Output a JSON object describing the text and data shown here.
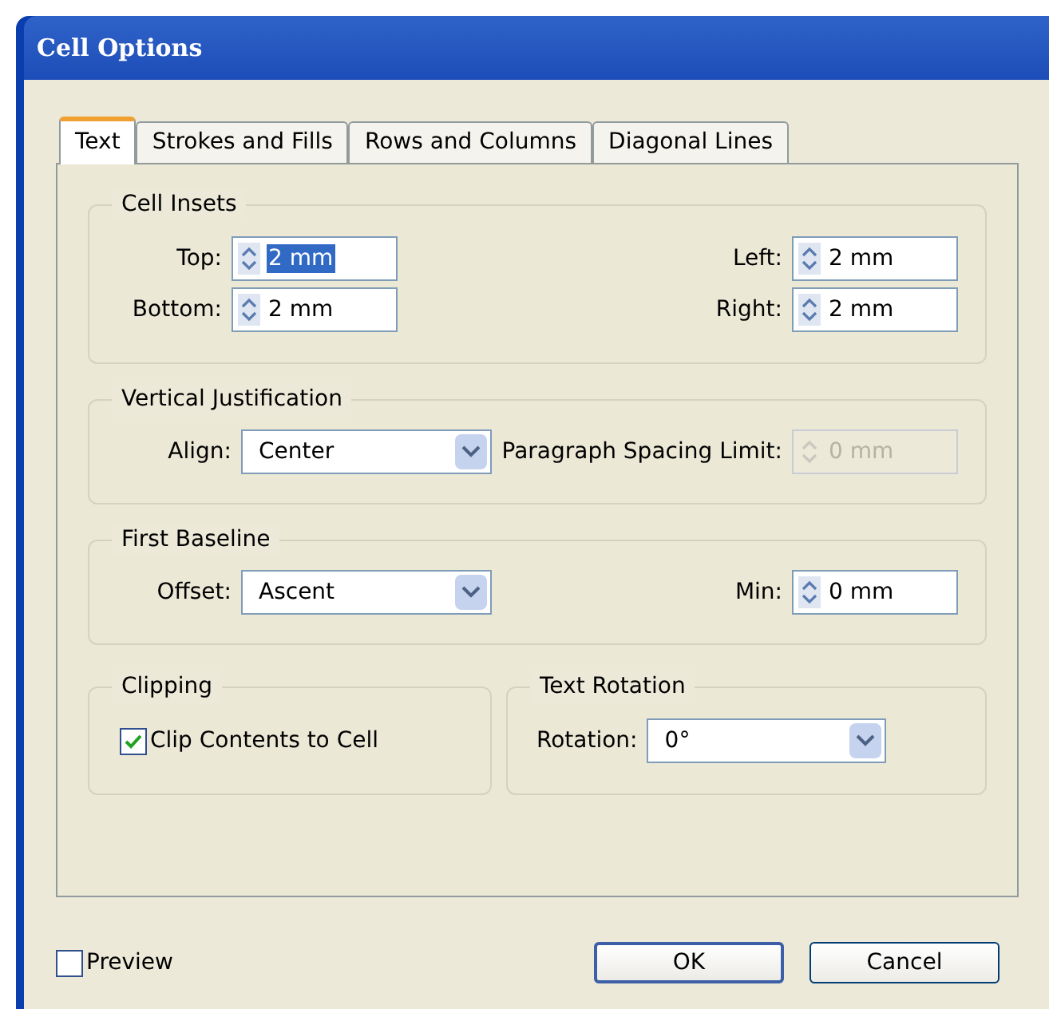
{
  "window": {
    "title": "Cell Options"
  },
  "tabs": [
    {
      "label": "Text",
      "selected": true
    },
    {
      "label": "Strokes and Fills",
      "selected": false
    },
    {
      "label": "Rows and Columns",
      "selected": false
    },
    {
      "label": "Diagonal Lines",
      "selected": false
    }
  ],
  "cell_insets": {
    "title": "Cell Insets",
    "fields": [
      {
        "label": "Top:",
        "value": "2 mm",
        "selected": true
      },
      {
        "label": "Left:",
        "value": "2 mm",
        "selected": false
      },
      {
        "label": "Bottom:",
        "value": "2 mm",
        "selected": false
      },
      {
        "label": "Right:",
        "value": "2 mm",
        "selected": false
      }
    ]
  },
  "vertical_justification": {
    "title": "Vertical Justification",
    "align": {
      "label": "Align:",
      "value": "Center"
    },
    "paragraph_spacing_limit": {
      "label": "Paragraph Spacing Limit:",
      "value": "0 mm",
      "disabled": true
    }
  },
  "first_baseline": {
    "title": "First Baseline",
    "offset": {
      "label": "Offset:",
      "value": "Ascent"
    },
    "min": {
      "label": "Min:",
      "value": "0 mm",
      "disabled": false
    }
  },
  "clipping": {
    "title": "Clipping",
    "checkbox": {
      "label": "Clip Contents to Cell",
      "checked": true
    }
  },
  "text_rotation": {
    "title": "Text Rotation",
    "rotation": {
      "label": "Rotation:",
      "value": "0°"
    }
  },
  "preview": {
    "label": "Preview",
    "checked": false
  },
  "buttons": [
    {
      "label": "OK",
      "default": true
    },
    {
      "label": "Cancel",
      "default": false
    }
  ]
}
